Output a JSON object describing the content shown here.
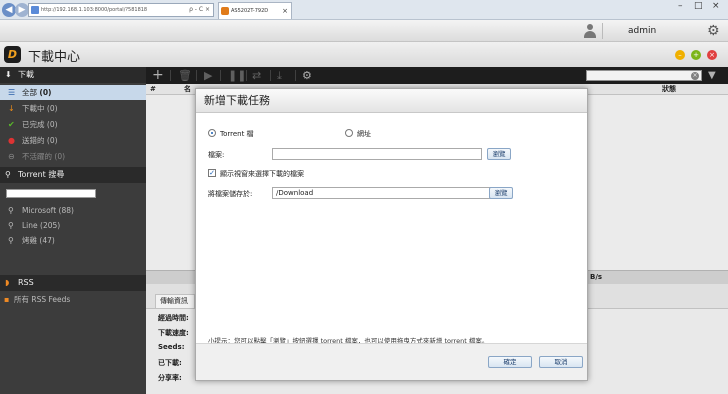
{
  "browser": {
    "address": "http://192.168.1.103:8000/portal/?581818",
    "address_controls": "ρ - C ×",
    "tab_title": "AS5202T-792D",
    "tab_close": "×",
    "win_min": "–",
    "win_max": "□",
    "win_close": "×"
  },
  "appbar": {
    "username": "admin"
  },
  "app": {
    "logo_letter": "D",
    "title": "下載中心"
  },
  "sidebar": {
    "download_header": "下載",
    "items": [
      {
        "label": "全部",
        "count": "(0)"
      },
      {
        "label": "下載中",
        "count": "(0)"
      },
      {
        "label": "已完成",
        "count": "(0)"
      },
      {
        "label": "送錯的",
        "count": "(0)"
      },
      {
        "label": "不活躍的",
        "count": "(0)"
      }
    ],
    "torrent_header": "Torrent 搜尋",
    "searches": [
      {
        "label": "Microsoft",
        "count": "(88)"
      },
      {
        "label": "Line",
        "count": "(205)"
      },
      {
        "label": "烤雞",
        "count": "(47)"
      }
    ],
    "rss_header": "RSS",
    "rss_item": "所有 RSS Feeds"
  },
  "table": {
    "col_num": "#",
    "col_name": "名",
    "col_status": "狀態"
  },
  "info": {
    "speed_suffix": "B/s",
    "tab_label": "傳輸資訊",
    "rows": [
      "經過時間:",
      "下載速度:",
      "Seeds:",
      "已下載:",
      "分享率:"
    ]
  },
  "dialog": {
    "title": "新增下載任務",
    "radio_torrent": "Torrent 檔",
    "radio_url": "網址",
    "file_label": "檔案:",
    "file_value": "",
    "browse": "瀏覽",
    "checkbox_label": "顯示視窗來選擇下載的檔案",
    "checkbox_checked": "✓",
    "save_label": "將檔案儲存於:",
    "save_value": "/Download",
    "tip": "小提示：您可以點擊「瀏覽」按鈕選擇 torrent 檔案，也可以使用拖曳方式來新增 torrent 檔案。",
    "ok": "確定",
    "cancel": "取消"
  },
  "colors": {
    "sidebar_bg": "#3c3c3c",
    "active_item": "#c7d8ea",
    "toolbar_bg": "#1f1f1f",
    "accent": "#1a5fb4"
  },
  "icons": [
    "back-icon",
    "forward-icon",
    "lock-icon",
    "tab-favicon-icon",
    "user-icon",
    "settings-gear-icon",
    "app-logo-icon",
    "minimize-icon",
    "maximize-icon",
    "close-icon",
    "add-icon",
    "delete-icon",
    "play-icon",
    "pause-icon",
    "shuffle-icon",
    "download-icon",
    "gear-icon",
    "clear-icon",
    "filter-icon",
    "list-icon",
    "arrow-down-icon",
    "check-icon",
    "error-icon",
    "inactive-icon",
    "search-icon",
    "rss-icon"
  ]
}
